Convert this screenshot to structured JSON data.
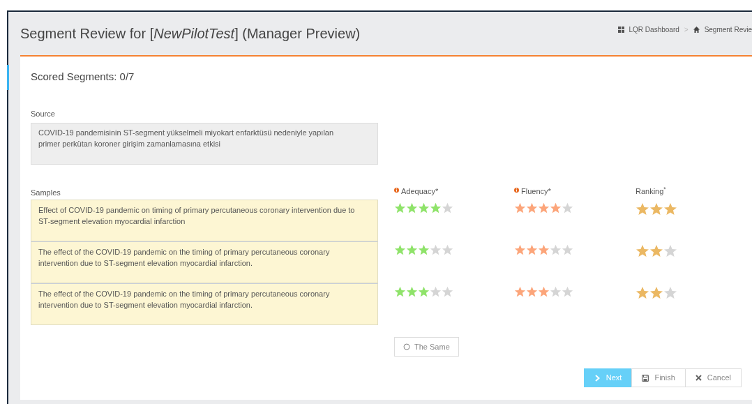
{
  "header": {
    "title": "Segment Review for [*NewPilotTest*] (Manager Preview)",
    "breadcrumb": [
      {
        "label": "LQR Dashboard"
      },
      {
        "label": "Segment Revie"
      }
    ],
    "separator": ">"
  },
  "scored": "Scored Segments: 0/7",
  "source": {
    "label": "Source",
    "text": "COVID-19 pandemisinin ST-segment yükselmeli miyokart enfarktüsü nedeniyle yapılan primer perkütan koroner girişim zamanlamasına etkisi"
  },
  "samples_label": "Samples",
  "columns": [
    {
      "label": "Adequacy*",
      "info": true,
      "kind": "scale5"
    },
    {
      "label": "Fluency*",
      "info": true,
      "kind": "scale5"
    },
    {
      "label": "Ranking$^{*}$",
      "info": false,
      "kind": "scale3"
    }
  ],
  "samples": [
    {
      "text": "Effect of COVID-19 pandemic on timing of primary percutaneous coronary intervention due to ST-segment elevation myocardial infarction",
      "ratings": [
        {
          "stars": 4
        },
        {
          "stars": 4
        },
        {
          "stars": 3
        }
      ]
    },
    {
      "text": "The effect of the COVID-19 pandemic on the timing of primary percutaneous coronary intervention due to ST-segment elevation myocardial infarction.",
      "ratings": [
        {
          "stars": 3
        },
        {
          "stars": 3
        },
        {
          "stars": 2
        }
      ]
    },
    {
      "text": "The effect of the COVID-19 pandemic on the timing of primary percutaneous coronary intervention due to ST-segment elevation myocardial infarction.",
      "ratings": [
        {
          "stars": 3
        },
        {
          "stars": 3
        },
        {
          "stars": 2
        }
      ]
    }
  ],
  "same_button": {
    "label": "The Same",
    "checked": false
  },
  "actions": [
    {
      "label": "Next",
      "kind": "primary"
    },
    {
      "label": "Finish",
      "kind": "default"
    },
    {
      "label": "Cancel",
      "kind": "default"
    }
  ]
}
